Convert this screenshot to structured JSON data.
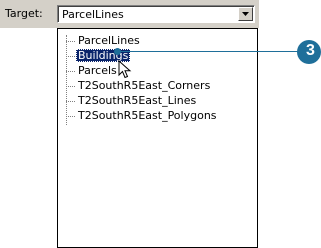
{
  "toolbar": {
    "target_label": "Target:",
    "target_value": "ParcelLines"
  },
  "dropdown": {
    "items": [
      {
        "label": "ParcelLines",
        "selected": false
      },
      {
        "label": "Buildings",
        "selected": true
      },
      {
        "label": "Parcels",
        "selected": false
      },
      {
        "label": "T2SouthR5East_Corners",
        "selected": false
      },
      {
        "label": "T2SouthR5East_Lines",
        "selected": false
      },
      {
        "label": "T2SouthR5East_Polygons",
        "selected": false
      }
    ]
  },
  "callout": {
    "number": "3",
    "color": "#1f6f9a"
  },
  "colors": {
    "selection": "#0a246a",
    "toolbar": "#d4d0c8"
  },
  "icons": {
    "combo_button": "chevron-down-icon",
    "cursor": "mouse-pointer-icon"
  }
}
